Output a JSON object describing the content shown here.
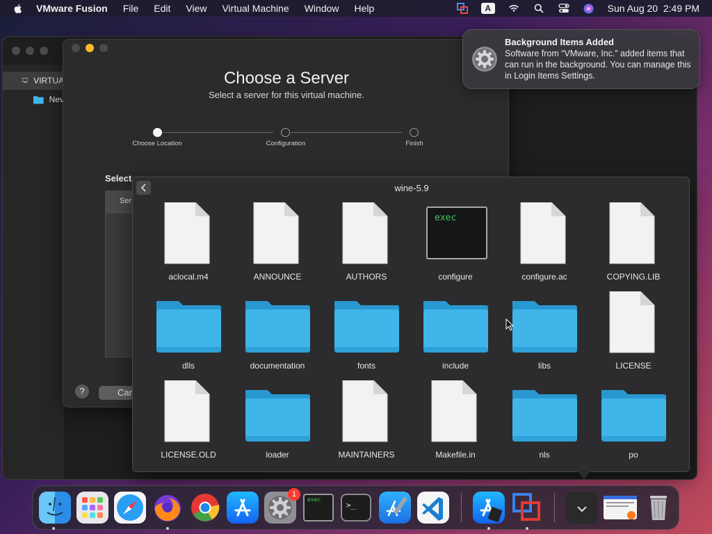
{
  "menubar": {
    "app_name": "VMware Fusion",
    "items": [
      "File",
      "Edit",
      "View",
      "Virtual Machine",
      "Window",
      "Help"
    ],
    "input_source": "A",
    "datetime": "Sun Aug 20  2:49 PM"
  },
  "library": {
    "rows": [
      {
        "label": "VIRTUA",
        "icon": "monitor-icon"
      },
      {
        "label": "Nev",
        "icon": "folder-icon"
      }
    ]
  },
  "dialog": {
    "title": "Choose a Server",
    "subtitle": "Select a server for this virtual machine.",
    "steps": [
      {
        "label": "Choose Location",
        "active": true
      },
      {
        "label": "Configuration",
        "active": false
      },
      {
        "label": "Finish",
        "active": false
      }
    ],
    "select_label": "Select",
    "table_header": "Ser",
    "help_label": "?",
    "cancel_label": "Can"
  },
  "notification": {
    "title": "Background Items Added",
    "body": "Software from “VMware, Inc.” added items that can run in the background. You can manage this in Login Items Settings."
  },
  "stack": {
    "title": "wine-5.9",
    "items": [
      {
        "name": "aclocal.m4",
        "kind": "document"
      },
      {
        "name": "ANNOUNCE",
        "kind": "document"
      },
      {
        "name": "AUTHORS",
        "kind": "document"
      },
      {
        "name": "configure",
        "kind": "exec",
        "exec_label": "exec"
      },
      {
        "name": "configure.ac",
        "kind": "document"
      },
      {
        "name": "COPYING.LIB",
        "kind": "document"
      },
      {
        "name": "dlls",
        "kind": "folder"
      },
      {
        "name": "documentation",
        "kind": "folder"
      },
      {
        "name": "fonts",
        "kind": "folder"
      },
      {
        "name": "include",
        "kind": "folder"
      },
      {
        "name": "libs",
        "kind": "folder"
      },
      {
        "name": "LICENSE",
        "kind": "document"
      },
      {
        "name": "LICENSE.OLD",
        "kind": "document"
      },
      {
        "name": "loader",
        "kind": "folder"
      },
      {
        "name": "MAINTAINERS",
        "kind": "document"
      },
      {
        "name": "Makefile.in",
        "kind": "document"
      },
      {
        "name": "nls",
        "kind": "folder"
      },
      {
        "name": "po",
        "kind": "folder"
      }
    ]
  },
  "dock": {
    "apps": [
      {
        "name": "finder-icon",
        "running": true
      },
      {
        "name": "launchpad-icon",
        "running": false
      },
      {
        "name": "safari-icon",
        "running": false
      },
      {
        "name": "firefox-icon",
        "running": true
      },
      {
        "name": "chrome-icon",
        "running": false
      },
      {
        "name": "app-store-icon",
        "running": false
      },
      {
        "name": "system-settings-icon",
        "running": false,
        "badge": "1"
      },
      {
        "name": "exec-terminal-icon",
        "running": false
      },
      {
        "name": "terminal-icon",
        "running": false
      },
      {
        "name": "xcode-icon",
        "running": false
      },
      {
        "name": "vscode-icon",
        "running": false
      },
      {
        "name": "app-store-developer-icon",
        "running": true
      },
      {
        "name": "vmware-fusion-icon",
        "running": true
      },
      {
        "name": "downloads-stack-icon",
        "running": false
      },
      {
        "name": "recent-document-icon",
        "running": false
      },
      {
        "name": "trash-icon",
        "running": false
      }
    ]
  },
  "colors": {
    "folder": "#3fb5ea",
    "folder_dark": "#2a98d0",
    "document": "#f2f2f2",
    "exec_text": "#3cc85a",
    "accent_yellow": "#f5bd2e",
    "badge_red": "#ff3b30"
  }
}
